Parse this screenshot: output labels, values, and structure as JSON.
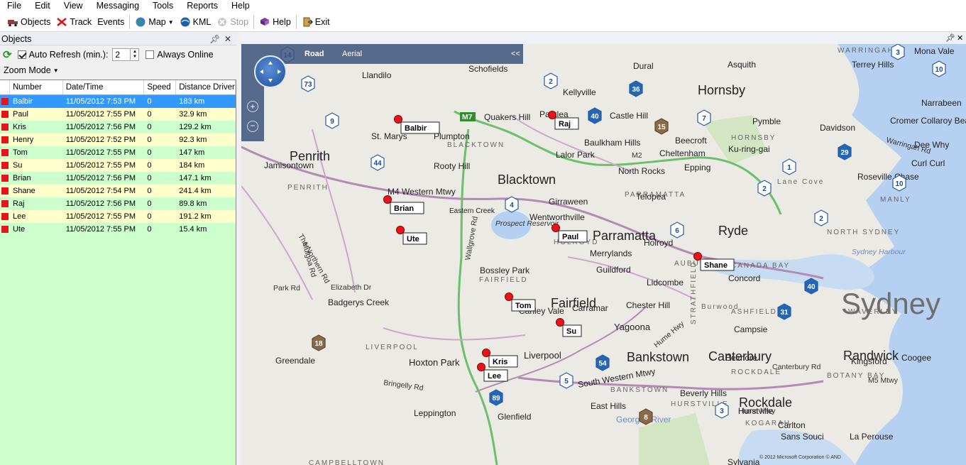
{
  "menu": [
    "File",
    "Edit",
    "View",
    "Messaging",
    "Tools",
    "Reports",
    "Help"
  ],
  "toolbar": {
    "objects": "Objects",
    "track": "Track",
    "events": "Events",
    "map": "Map",
    "kml": "KML",
    "stop": "Stop",
    "help": "Help",
    "exit": "Exit"
  },
  "objects_panel": {
    "title": "Objects",
    "auto_refresh_label": "Auto Refresh (min.):",
    "auto_refresh_checked": true,
    "refresh_value": "2",
    "always_online_label": "Always Online",
    "always_online_checked": false,
    "zoom_mode": "Zoom Mode"
  },
  "grid": {
    "columns": [
      "Number",
      "Date/Time",
      "Speed",
      "Distance Driven"
    ],
    "rows": [
      {
        "name": "Balbir",
        "datetime": "11/05/2012 7:53 PM",
        "speed": "0",
        "distance": "183 km",
        "style": "selected"
      },
      {
        "name": "Paul",
        "datetime": "11/05/2012 7:55 PM",
        "speed": "0",
        "distance": "32.9 km",
        "style": "yellow"
      },
      {
        "name": "Kris",
        "datetime": "11/05/2012 7:56 PM",
        "speed": "0",
        "distance": "129.2 km",
        "style": "green"
      },
      {
        "name": "Henry",
        "datetime": "11/05/2012 7:52 PM",
        "speed": "0",
        "distance": "92.3 km",
        "style": "yellow"
      },
      {
        "name": "Tom",
        "datetime": "11/05/2012 7:55 PM",
        "speed": "0",
        "distance": "147 km",
        "style": "green"
      },
      {
        "name": "Su",
        "datetime": "11/05/2012 7:55 PM",
        "speed": "0",
        "distance": "184 km",
        "style": "yellow"
      },
      {
        "name": "Brian",
        "datetime": "11/05/2012 7:56 PM",
        "speed": "0",
        "distance": "147.1 km",
        "style": "green"
      },
      {
        "name": "Shane",
        "datetime": "11/05/2012 7:54 PM",
        "speed": "0",
        "distance": "241.4 km",
        "style": "yellow"
      },
      {
        "name": "Raj",
        "datetime": "11/05/2012 7:56 PM",
        "speed": "0",
        "distance": "89.8 km",
        "style": "green"
      },
      {
        "name": "Lee",
        "datetime": "11/05/2012 7:55 PM",
        "speed": "0",
        "distance": "191.2 km",
        "style": "yellow"
      },
      {
        "name": "Ute",
        "datetime": "11/05/2012 7:55 PM",
        "speed": "0",
        "distance": "15.4 km",
        "style": "green"
      }
    ]
  },
  "map": {
    "mode_road": "Road",
    "mode_aerial": "Aerial",
    "collapse": "<<",
    "copyright": "© 2012 Microsoft Corporation  © AND",
    "markers": [
      "Balbir",
      "Raj",
      "Brian",
      "Ute",
      "Paul",
      "Shane",
      "Tom",
      "Su",
      "Kris",
      "Lee"
    ],
    "cities": [
      "Penrith",
      "Blacktown",
      "Parramatta",
      "Ryde",
      "Fairfield",
      "Bankstown",
      "Canterbury",
      "Randwick",
      "Rockdale",
      "Hornsby",
      "Sydney"
    ],
    "towns": [
      "Schofields",
      "Llandilo",
      "Kellyville",
      "Dural",
      "Asquith",
      "Mona Vale",
      "Terrey Hills",
      "Quakers Hill",
      "Parklea",
      "Castle Hill",
      "St. Marys",
      "Plumpton",
      "Baulkham Hills",
      "Pymble",
      "Davidson",
      "Narrabeen",
      "Cromer Collaroy Beach",
      "Beecroft",
      "Cheltenham",
      "Ku-ring-gai",
      "Dee Why",
      "Jamisontown",
      "Rooty Hill",
      "Lalor Park",
      "North Rocks",
      "Epping",
      "Curl Curl",
      "Roseville Chase",
      "Girraween",
      "Telopea",
      "Eastern Creek",
      "Wentworthville",
      "Holroyd",
      "Merrylands",
      "Bossley Park",
      "Guildford",
      "Lidcombe",
      "Concord",
      "Badgerys Creek",
      "Canley Vale",
      "Carramar",
      "Chester Hill",
      "Yagoona",
      "Campsie",
      "Greendale",
      "Hoxton Park",
      "Liverpool",
      "Kingsford",
      "Coogee",
      "Belmore",
      "Beverly Hills",
      "Hurstville",
      "Leppington",
      "Glenfield",
      "East Hills",
      "Georges River",
      "Carlton",
      "Sans Souci",
      "La Perouse",
      "Sylvania",
      "Burwood",
      "Lane Cove"
    ],
    "districts": [
      "BLACKTOWN",
      "PENRITH",
      "PARRAMATTA",
      "FAIRFIELD",
      "LIVERPOOL",
      "BANKSTOWN",
      "HORNSBY",
      "WARRINGAH",
      "HOLROYD",
      "AUBURN",
      "CANADA BAY",
      "ASHFIELD",
      "WAVERLEY",
      "BOTANY BAY",
      "ROCKDALE",
      "KOGARAH",
      "HURSTVILLE",
      "STRATHFIELD",
      "NORTH SYDNEY",
      "MANLY",
      "CAMPBELLTOWN"
    ],
    "roads": [
      "M7",
      "M4 Western Mtwy",
      "M2",
      "M5 Mtwy",
      "South Western Mtwy",
      "Hume Hwy",
      "Wallgrove Rd",
      "Mulgoa Rd",
      "The Northern Rd",
      "Park Rd",
      "Elizabeth Dr",
      "Bringelly Rd",
      "Canterbury Rd",
      "Hume Mwy",
      "Warringah Rd"
    ],
    "shields": [
      "14",
      "73",
      "2",
      "36",
      "40",
      "10",
      "3",
      "9",
      "7",
      "15",
      "29",
      "44",
      "1",
      "4",
      "2",
      "2",
      "10",
      "6",
      "40",
      "31",
      "18",
      "54",
      "89",
      "5",
      "3",
      "8"
    ],
    "reservoir": "Prospect Reservoir",
    "harbour": "Sydney Harbour"
  },
  "colors": {
    "selected": "#3399ff",
    "marker": "#e8141c",
    "grid_bg": "#ccffcc",
    "yellow_row": "#ffffcc"
  }
}
